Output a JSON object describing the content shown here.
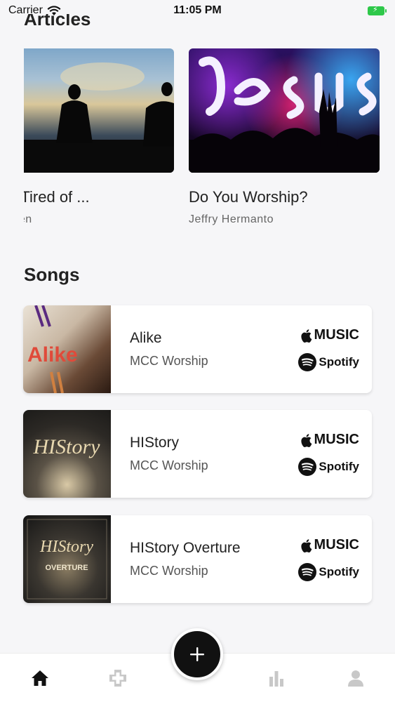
{
  "status_bar": {
    "carrier": "Carrier",
    "time": "11:05 PM"
  },
  "articles": {
    "title": "Articles",
    "items": [
      {
        "title": ": Get Tired of ...",
        "author": "< Warren",
        "image": "silhouette-sunset"
      },
      {
        "title": "Do You Worship?",
        "author": "Jeffry Hermanto",
        "image": "worship-concert"
      }
    ]
  },
  "songs": {
    "title": "Songs",
    "items": [
      {
        "name": "Alike",
        "artist": "MCC Worship",
        "apple_label": "MUSIC",
        "spotify_label": "Spotify",
        "art_text": "Alike"
      },
      {
        "name": "HIStory",
        "artist": "MCC Worship",
        "apple_label": "MUSIC",
        "spotify_label": "Spotify",
        "art_text": "HIStory"
      },
      {
        "name": "HIStory Overture",
        "artist": "MCC Worship",
        "apple_label": "MUSIC",
        "spotify_label": "Spotify",
        "art_text": "HIStory",
        "art_subtext": "OVERTURE"
      }
    ]
  },
  "tab_bar": {
    "tabs": [
      "home-icon",
      "church-icon",
      "add-icon",
      "stats-icon",
      "profile-icon"
    ]
  },
  "colors": {
    "background": "#f6f6f8",
    "fab": "#111111",
    "battery": "#2ec84a",
    "tab_active": "#111111",
    "tab_inactive": "#c8c8c8"
  }
}
